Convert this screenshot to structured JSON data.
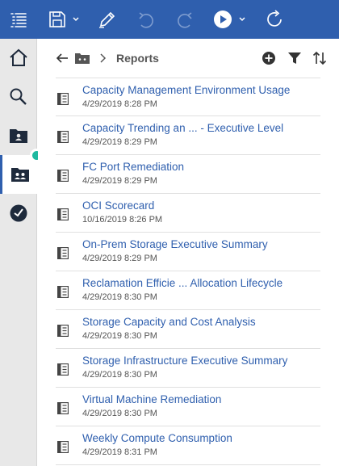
{
  "toolbar": {
    "icons": [
      "menu-icon",
      "save-icon",
      "edit-icon",
      "undo-icon",
      "redo-icon",
      "run-icon",
      "refresh-icon"
    ],
    "color": "#2f5fae"
  },
  "rail": {
    "items": [
      "home-icon",
      "search-icon",
      "my-content-icon",
      "team-content-icon",
      "recent-icon"
    ],
    "active": "team-content-icon",
    "badge_color": "#1eb9a0"
  },
  "nav": {
    "breadcrumb_current": "Reports",
    "icons": [
      "back-arrow-icon",
      "folder-icon",
      "chevron-right-icon",
      "add-icon",
      "filter-icon",
      "sort-icon"
    ]
  },
  "reports": [
    {
      "title": "Capacity Management Environment Usage",
      "date": "4/29/2019 8:28 PM"
    },
    {
      "title": "Capacity Trending an ... - Executive Level",
      "date": "4/29/2019 8:29 PM"
    },
    {
      "title": "FC Port Remediation",
      "date": "4/29/2019 8:29 PM"
    },
    {
      "title": "OCI Scorecard",
      "date": "10/16/2019 8:26 PM"
    },
    {
      "title": "On-Prem Storage Executive Summary",
      "date": "4/29/2019 8:29 PM"
    },
    {
      "title": "Reclamation Efficie ... Allocation Lifecycle",
      "date": "4/29/2019 8:30 PM"
    },
    {
      "title": "Storage Capacity and Cost Analysis",
      "date": "4/29/2019 8:30 PM"
    },
    {
      "title": "Storage Infrastructure Executive Summary",
      "date": "4/29/2019 8:30 PM"
    },
    {
      "title": "Virtual Machine Remediation",
      "date": "4/29/2019 8:30 PM"
    },
    {
      "title": "Weekly Compute Consumption",
      "date": "4/29/2019 8:31 PM"
    }
  ],
  "colors": {
    "link": "#2f5fae",
    "text_secondary": "#555555"
  }
}
